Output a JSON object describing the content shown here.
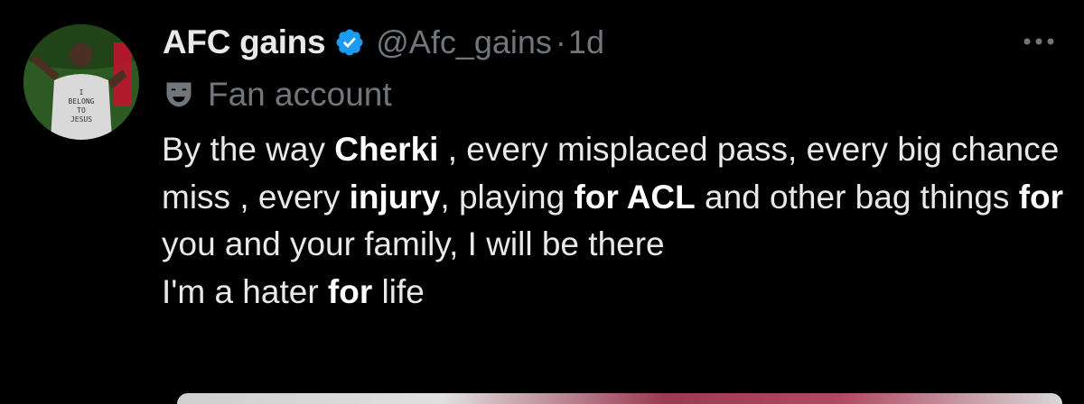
{
  "tweet": {
    "author": {
      "display_name": "AFC gains",
      "handle": "@Afc_gains",
      "verified": true,
      "avatar_icon": "avatar-image"
    },
    "separator": "·",
    "time": "1d",
    "account_label": {
      "icon": "mask-icon",
      "text": "Fan account"
    },
    "body": {
      "segments": [
        {
          "text": "By the way ",
          "bold": false
        },
        {
          "text": "Cherki",
          "bold": true
        },
        {
          "text": " , every misplaced pass, every big chance miss , every ",
          "bold": false
        },
        {
          "text": "injury",
          "bold": true
        },
        {
          "text": ", playing ",
          "bold": false
        },
        {
          "text": "for ACL",
          "bold": true
        },
        {
          "text": " and other bag things ",
          "bold": false
        },
        {
          "text": "for",
          "bold": true
        },
        {
          "text": " you and your family, I will be there",
          "bold": false
        },
        {
          "text": "\n",
          "bold": false
        },
        {
          "text": "I'm a hater ",
          "bold": false
        },
        {
          "text": "for",
          "bold": true
        },
        {
          "text": " life",
          "bold": false
        }
      ]
    },
    "more_icon": "more-options-icon"
  },
  "colors": {
    "background": "#000000",
    "primary_text": "#e7e9ea",
    "secondary_text": "#71767b",
    "verified_blue": "#1d9bf0"
  }
}
